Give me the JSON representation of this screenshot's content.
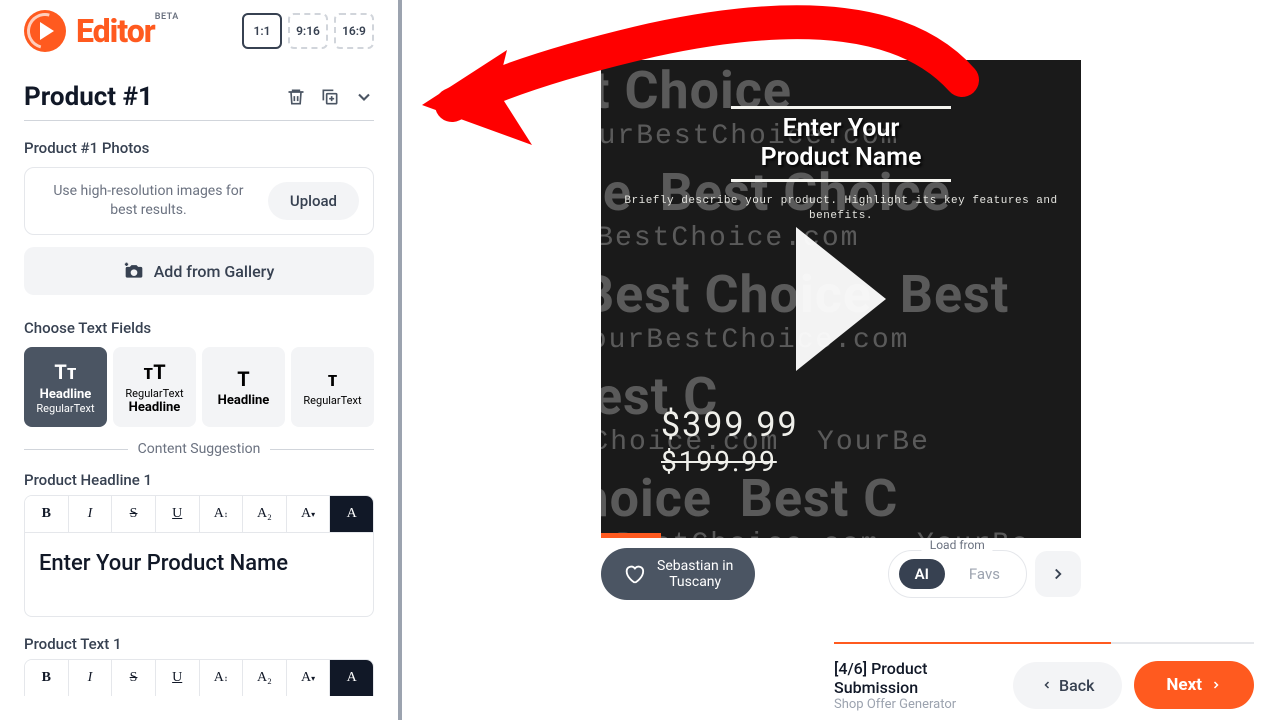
{
  "brand": {
    "name": "Editor",
    "badge": "BETA"
  },
  "ratios": [
    "1:1",
    "9:16",
    "16:9"
  ],
  "product": {
    "title": "Product #1",
    "photos_label": "Product #1 Photos",
    "upload_hint": "Use high-resolution images for best results.",
    "upload_button": "Upload",
    "gallery_button": "Add from Gallery",
    "choose_fields_label": "Choose Text Fields",
    "field_options": [
      {
        "icon": "Tᴛ",
        "l1": "Headline",
        "l2": "RegularText"
      },
      {
        "icon": "ᴛT",
        "l1": "RegularText",
        "l2": "Headline"
      },
      {
        "icon": "T",
        "l1": "Headline",
        "l2": ""
      },
      {
        "icon": "ᴛ",
        "l1": "RegularText",
        "l2": ""
      }
    ],
    "suggestion_label": "Content Suggestion",
    "headline1_label": "Product Headline 1",
    "headline1_value": "Enter Your Product Name",
    "text1_label": "Product Text 1"
  },
  "toolbar_items": [
    "B",
    "I",
    "S",
    "U",
    "A",
    "A₂",
    "A",
    "A"
  ],
  "canvas": {
    "bg_big": "Best Choice",
    "bg_small": "YourBestChoice.com",
    "title_line1": "Enter Your",
    "title_line2": "Product Name",
    "desc": "Briefly describe your product. Highlight its key features and benefits.",
    "price": "$399.99",
    "old_price": "$199.99"
  },
  "music": {
    "line1": "Sebastian in",
    "line2": "Tuscany"
  },
  "load": {
    "label": "Load from",
    "ai": "AI",
    "favs": "Favs"
  },
  "footer": {
    "step": "[4/6] Product Submission",
    "sub": "Shop Offer Generator",
    "back": "Back",
    "next": "Next"
  }
}
